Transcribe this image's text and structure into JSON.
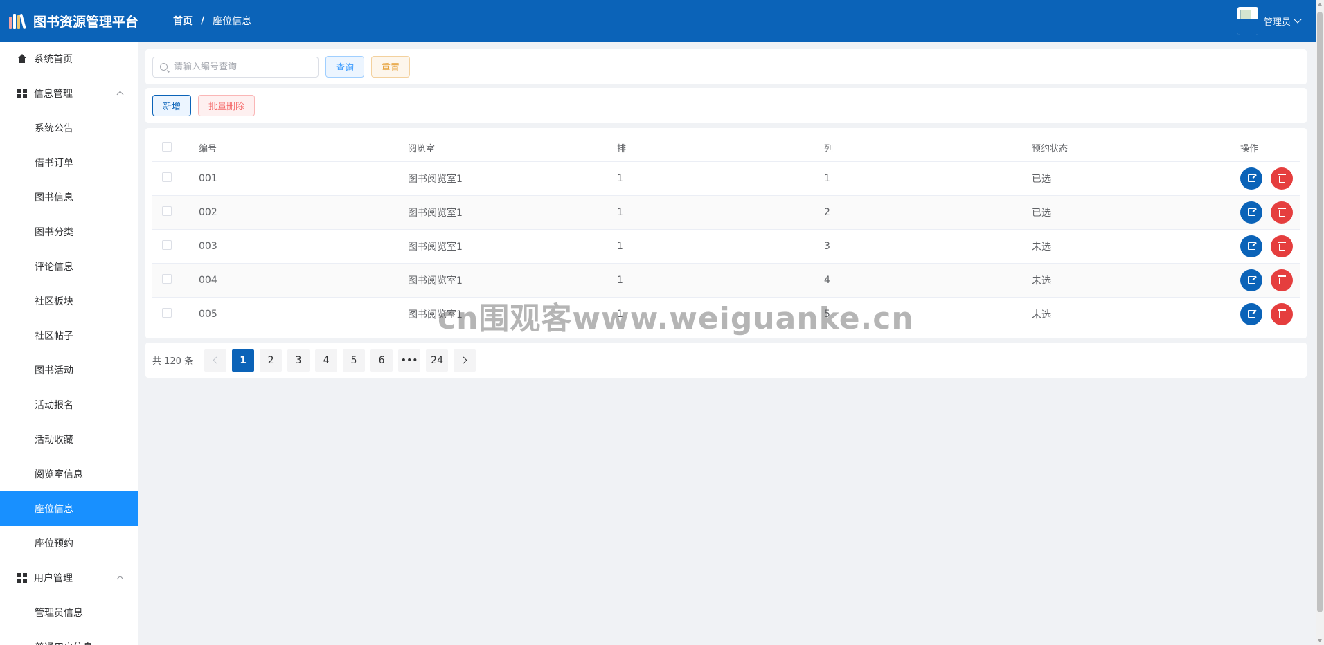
{
  "header": {
    "app_title": "图书资源管理平台",
    "breadcrumb": {
      "home": "首页",
      "separator": "/",
      "current": "座位信息"
    },
    "user": {
      "name": "管理员"
    },
    "colors": {
      "bar": "#0b63b8"
    }
  },
  "sidebar": {
    "items": [
      {
        "label": "系统首页",
        "icon": "home-icon",
        "level": "top"
      },
      {
        "label": "信息管理",
        "icon": "grid-icon",
        "level": "top",
        "expanded": true
      },
      {
        "label": "系统公告",
        "level": "sub"
      },
      {
        "label": "借书订单",
        "level": "sub"
      },
      {
        "label": "图书信息",
        "level": "sub"
      },
      {
        "label": "图书分类",
        "level": "sub"
      },
      {
        "label": "评论信息",
        "level": "sub"
      },
      {
        "label": "社区板块",
        "level": "sub"
      },
      {
        "label": "社区帖子",
        "level": "sub"
      },
      {
        "label": "图书活动",
        "level": "sub"
      },
      {
        "label": "活动报名",
        "level": "sub"
      },
      {
        "label": "活动收藏",
        "level": "sub"
      },
      {
        "label": "阅览室信息",
        "level": "sub"
      },
      {
        "label": "座位信息",
        "level": "sub",
        "active": true
      },
      {
        "label": "座位预约",
        "level": "sub"
      },
      {
        "label": "用户管理",
        "icon": "grid-icon",
        "level": "top",
        "expanded": true
      },
      {
        "label": "管理员信息",
        "level": "sub"
      },
      {
        "label": "普通用户信息",
        "level": "sub"
      }
    ],
    "active_color": "#1890ff"
  },
  "search": {
    "placeholder": "请输入编号查询",
    "value": "",
    "query_label": "查询",
    "reset_label": "重置"
  },
  "actions": {
    "add_label": "新增",
    "batch_delete_label": "批量删除"
  },
  "table": {
    "columns": [
      "编号",
      "阅览室",
      "排",
      "列",
      "预约状态",
      "操作"
    ],
    "rows": [
      {
        "id": "001",
        "room": "图书阅览室1",
        "row": "1",
        "col": "1",
        "status": "已选"
      },
      {
        "id": "002",
        "room": "图书阅览室1",
        "row": "1",
        "col": "2",
        "status": "已选"
      },
      {
        "id": "003",
        "room": "图书阅览室1",
        "row": "1",
        "col": "3",
        "status": "未选"
      },
      {
        "id": "004",
        "room": "图书阅览室1",
        "row": "1",
        "col": "4",
        "status": "未选"
      },
      {
        "id": "005",
        "room": "图书阅览室1",
        "row": "1",
        "col": "5",
        "status": "未选"
      }
    ]
  },
  "pagination": {
    "total_text": "共 120 条",
    "pages": [
      "1",
      "2",
      "3",
      "4",
      "5",
      "6"
    ],
    "ellipsis": "•••",
    "last_page": "24",
    "current": "1"
  },
  "watermark": "cn围观客www.weiguanke.cn"
}
